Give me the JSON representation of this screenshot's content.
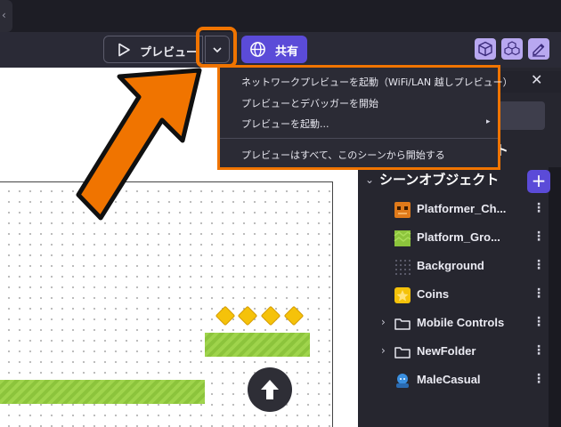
{
  "toolbar": {
    "tab_chevron": "‹",
    "preview_label": "プレビュー",
    "share_label": "共有",
    "icons": [
      "cube-icon",
      "cubes-icon",
      "edit-icon"
    ]
  },
  "colors": {
    "accent": "#5b4bd8",
    "highlight": "#f07400",
    "platform": "#8cc43c",
    "coin": "#f5c20a"
  },
  "menu": {
    "items": [
      "ネットワークプレビューを起動（WiFi/LAN 越しプレビュー）",
      "プレビューとデバッガーを開始",
      "プレビューを起動...",
      "プレビューはすべて、このシーンから開始する"
    ],
    "submenu_arrow": "▸"
  },
  "panel": {
    "close": "✕",
    "title_partial": "ェクト",
    "scene_title": "シーンオブジェクト",
    "add": "+",
    "objects": [
      {
        "name": "Platformer_Ch...",
        "icon": "character-icon",
        "expandable": false
      },
      {
        "name": "Platform_Gro...",
        "icon": "grass-tile-icon",
        "expandable": false
      },
      {
        "name": "Background",
        "icon": "dots-grid-icon",
        "expandable": false
      },
      {
        "name": "Coins",
        "icon": "coin-icon",
        "expandable": false
      },
      {
        "name": "Mobile Controls",
        "icon": "folder-icon",
        "expandable": true
      },
      {
        "name": "NewFolder",
        "icon": "folder-icon",
        "expandable": true
      },
      {
        "name": "MaleCasual",
        "icon": "avatar-icon",
        "expandable": false
      }
    ]
  }
}
